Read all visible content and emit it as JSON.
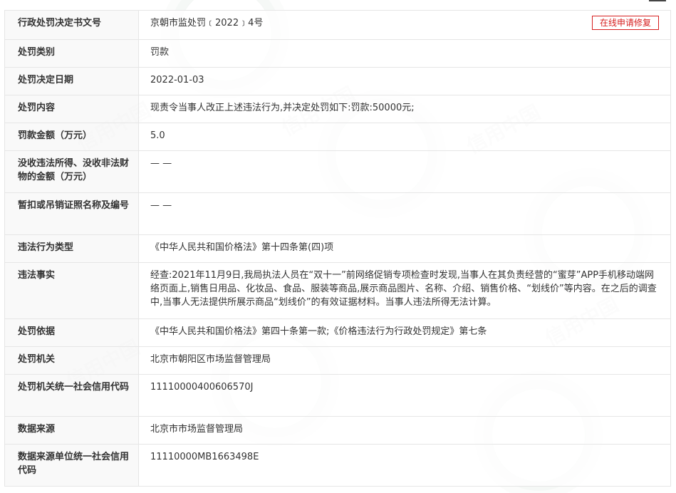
{
  "toolbar": {
    "repair_button_label": "在线申请修复"
  },
  "watermark": {
    "text": "信用中国"
  },
  "rows": [
    {
      "label": "行政处罚决定书文号",
      "value": "京朝市监处罚﹝2022﹞4号"
    },
    {
      "label": "处罚类别",
      "value": "罚款"
    },
    {
      "label": "处罚决定日期",
      "value": "2022-01-03"
    },
    {
      "label": "处罚内容",
      "value": "现责令当事人改正上述违法行为,并决定处罚如下:罚款:50000元;"
    },
    {
      "label": "罚款金额（万元）",
      "value": "5.0"
    },
    {
      "label": "没收违法所得、没收非法财物的金额（万元）",
      "value": "— —"
    },
    {
      "label": "暂扣或吊销证照名称及编号",
      "value": "— —"
    },
    {
      "label": "违法行为类型",
      "value": "《中华人民共和国价格法》第十四条第(四)项"
    },
    {
      "label": "违法事实",
      "value": "经查:2021年11月9日,我局执法人员在“双十一”前网络促销专项检查时发现,当事人在其负责经营的“蜜芽”APP手机移动端网络页面上,销售日用品、化妆品、食品、服装等商品,展示商品图片、名称、介绍、销售价格、“划线价”等内容。在之后的调查中,当事人无法提供所展示商品“划线价”的有效证据材料。当事人违法所得无法计算。"
    },
    {
      "label": "处罚依据",
      "value": "《中华人民共和国价格法》第四十条第一款;《价格违法行为行政处罚规定》第七条"
    },
    {
      "label": "处罚机关",
      "value": "北京市朝阳区市场监督管理局"
    },
    {
      "label": "处罚机关统一社会信用代码",
      "value": "11110000400606570J"
    },
    {
      "label": "数据来源",
      "value": "北京市市场监督管理局"
    },
    {
      "label": "数据来源单位统一社会信用代码",
      "value": "11110000MB1663498E"
    }
  ]
}
